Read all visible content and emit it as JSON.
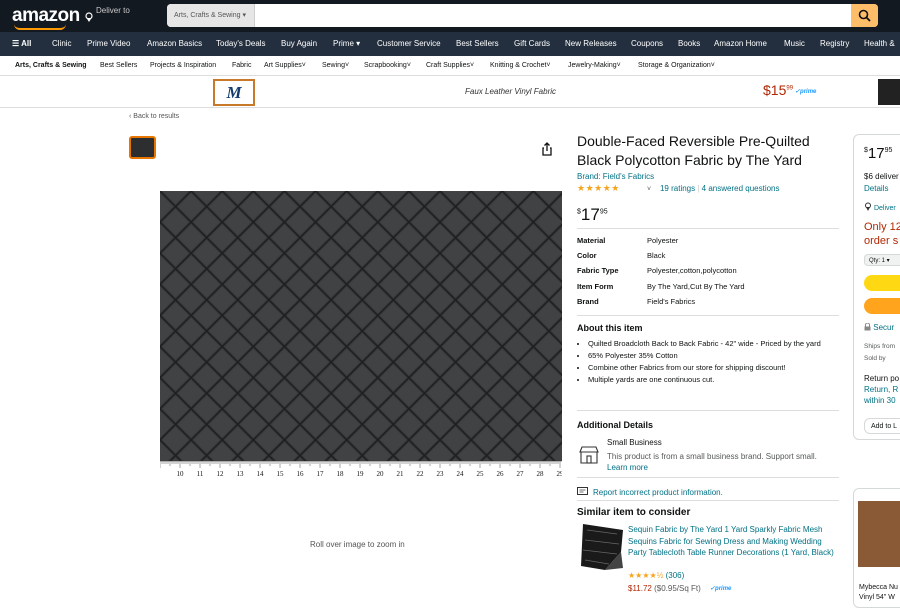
{
  "header": {
    "logo": "amazon",
    "deliver_label": "Deliver to",
    "search_category": "Arts, Crafts & Sewing"
  },
  "nav": {
    "items": [
      "All",
      "Clinic",
      "Prime Video",
      "Amazon Basics",
      "Today's Deals",
      "Buy Again",
      "Prime",
      "Customer Service",
      "Best Sellers",
      "Gift Cards",
      "New Releases",
      "Coupons",
      "Books",
      "Amazon Home",
      "Music",
      "Registry",
      "Health &"
    ]
  },
  "subnav": {
    "items": [
      "Arts, Crafts & Sewing",
      "Best Sellers",
      "Projects & Inspiration",
      "Fabric",
      "Art Supplies",
      "Sewing",
      "Scrapbooking",
      "Craft Supplies",
      "Knitting & Crochet",
      "Jewelry-Making",
      "Storage & Organization"
    ]
  },
  "banner": {
    "logo_text": "M",
    "product": "Faux Leather Vinyl Fabric",
    "price_whole": "$15",
    "price_frac": "99",
    "prime": "✓prime"
  },
  "product": {
    "back": "‹ Back to results",
    "title": "Double-Faced Reversible Pre-Quilted Black Polycotton Fabric by The Yard",
    "brand": "Brand: Field's Fabrics",
    "stars": "★★★★★",
    "ratings": "19 ratings",
    "sep": "|",
    "answered": "4 answered questions",
    "price_sym": "$",
    "price_whole": "17",
    "price_frac": "95",
    "roll": "Roll over image to zoom in",
    "specs": [
      {
        "k": "Material",
        "v": "Polyester"
      },
      {
        "k": "Color",
        "v": "Black"
      },
      {
        "k": "Fabric Type",
        "v": "Polyester,cotton,polycotton"
      },
      {
        "k": "Item Form",
        "v": "By The Yard,Cut By The Yard"
      },
      {
        "k": "Brand",
        "v": "Field's Fabrics"
      }
    ],
    "about_title": "About this item",
    "about": [
      "Quilted Broadcloth Back to Back Fabric - 42\" wide - Priced by the yard",
      "65% Polyester 35% Cotton",
      "Combine other Fabrics from our store for shipping discount!",
      "Multiple yards are one continuous cut."
    ],
    "additional_title": "Additional Details",
    "small_business": "Small Business",
    "sb_desc": "This product is from a small business brand. Support small.",
    "learn_more": "Learn more",
    "report": "Report incorrect product information.",
    "similar_title": "Similar item to consider",
    "similar_text": "Sequin Fabric by The Yard 1 Yard Sparkly Fabric Mesh Sequins Fabric for Sewing Dress and Making Wedding Party Tablecloth Table Runner Decorations (1 Yard, Black)",
    "similar_stars": "★★★★½",
    "similar_count": "(306)",
    "similar_price": "$11.72",
    "similar_unit": "($0.95/Sq Ft)",
    "similar_prime": "✓prime",
    "ruler_numbers": [
      "10",
      "11",
      "12",
      "13",
      "14",
      "15",
      "16",
      "17",
      "18",
      "19",
      "20",
      "21",
      "22",
      "23",
      "24",
      "25",
      "26",
      "27",
      "28",
      "29"
    ]
  },
  "buybox": {
    "price_sym": "$",
    "price_whole": "17",
    "price_frac": "95",
    "delivery": "$6 deliver",
    "details": "Details",
    "deliver_to": "Deliver",
    "stock": "Only 12",
    "stock2": "order s",
    "qty": "Qty: 1",
    "secure": "Secur",
    "ships": "Ships from",
    "sold": "Sold by",
    "returns": "Return po",
    "returns2": "Return, R",
    "returns3": "within 30",
    "add_list": "Add to L"
  },
  "related": {
    "name": "Mybecca Nu",
    "name2": "Vinyl 54\" W"
  }
}
